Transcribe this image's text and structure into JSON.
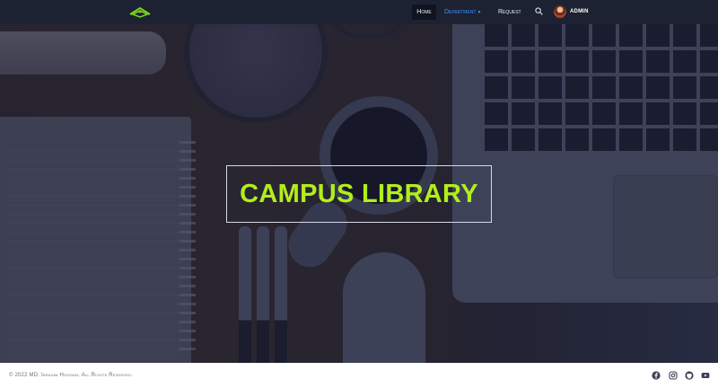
{
  "nav": {
    "home": "Home",
    "department": "Department",
    "request": "Request",
    "user": "ADMIN"
  },
  "hero": {
    "title": "CAMPUS LIBRARY"
  },
  "footer": {
    "copyright": "© 2022 MD. Ibrahim Hossain. All Rights Reserved.",
    "social": [
      "facebook-icon",
      "instagram-icon",
      "github-icon",
      "youtube-icon"
    ]
  },
  "colors": {
    "accent": "#b2ee1c",
    "nav_bg": "#1c2231",
    "link_active": "#3d8bff"
  }
}
